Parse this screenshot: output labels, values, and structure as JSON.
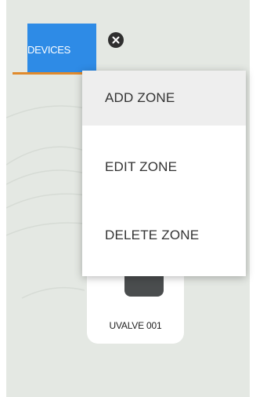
{
  "tabs": {
    "devices_label": "DEVICES"
  },
  "context_menu": {
    "items": [
      {
        "label": "ADD ZONE",
        "hovered": true
      },
      {
        "label": "EDIT ZONE",
        "hovered": false
      },
      {
        "label": "DELETE ZONE",
        "hovered": false
      }
    ]
  },
  "device_card": {
    "label": "UVALVE 001"
  },
  "colors": {
    "canvas": "#e4e8e3",
    "tab_active": "#2e8be6",
    "tab_underline": "#e08a2c",
    "menu_hover": "#eeeeee"
  },
  "icons": {
    "close": "close-circle-icon",
    "device": "valve-icon"
  }
}
